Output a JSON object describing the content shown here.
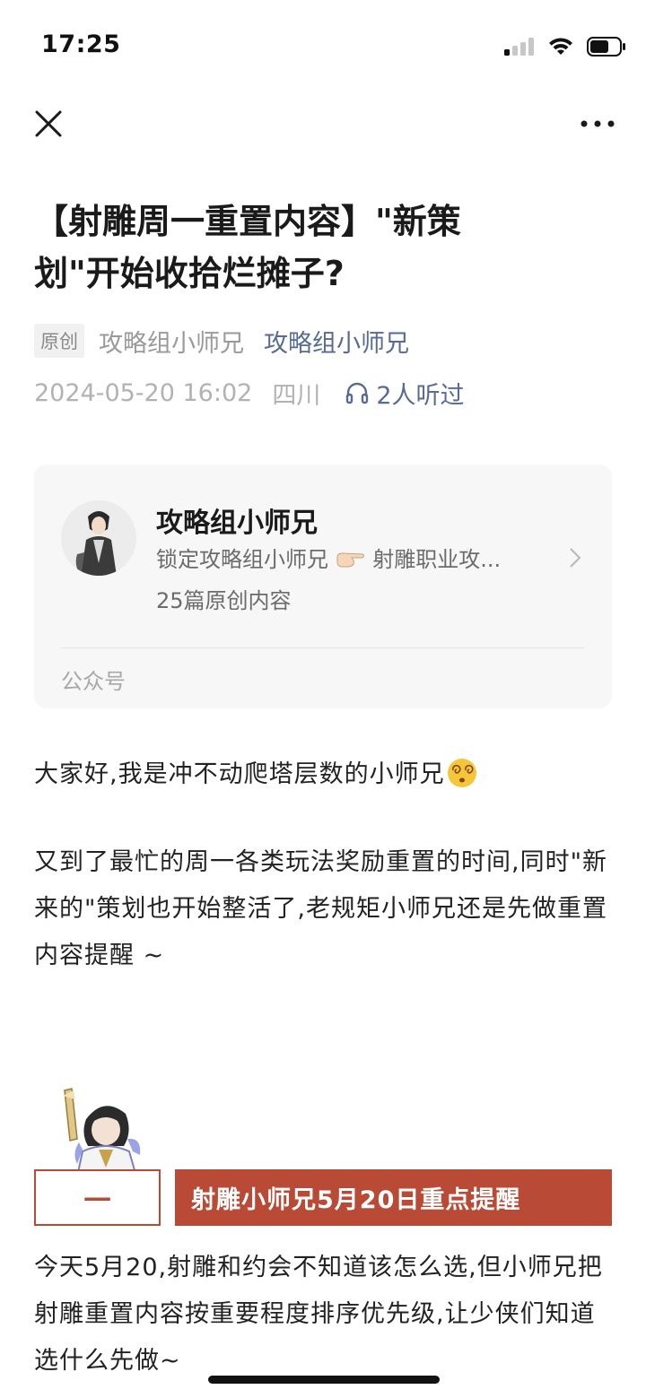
{
  "status_bar": {
    "time": "17:25",
    "signal_icon": "cellular-signal-icon",
    "wifi_icon": "wifi-icon",
    "battery_icon": "battery-icon"
  },
  "nav": {
    "close_icon": "close-icon",
    "more_icon": "more-dots-icon"
  },
  "article": {
    "title_line1": "【射雕周一重置内容】\"新策",
    "title_line2": "划\"开始收拾烂摊子?",
    "original_badge": "原创",
    "author_plain": "攻略组小师兄",
    "author_link": "攻略组小师兄",
    "datetime": "2024-05-20 16:02",
    "location": "四川",
    "listen_count": "2人听过"
  },
  "account_card": {
    "name": "攻略组小师兄",
    "desc_prefix": "锁定攻略组小师兄",
    "desc_suffix": "射雕职业攻...",
    "count": "25篇原创内容",
    "type": "公众号"
  },
  "body": {
    "p1": "大家好,我是冲不动爬塔层数的小师兄",
    "p2": "又到了最忙的周一各类玩法奖励重置的时间,同时\"新来的\"策划也开始整活了,老规矩小师兄还是先做重置内容提醒 ~",
    "section_number": "一",
    "section_title": "射雕小师兄5月20日重点提醒",
    "p3": "今天5月20,射雕和约会不知道该怎么选,但小师兄把射雕重置内容按重要程度排序优先级,让少侠们知道选什么先做~"
  },
  "colors": {
    "link": "#576b95",
    "accent": "#b94a35"
  }
}
